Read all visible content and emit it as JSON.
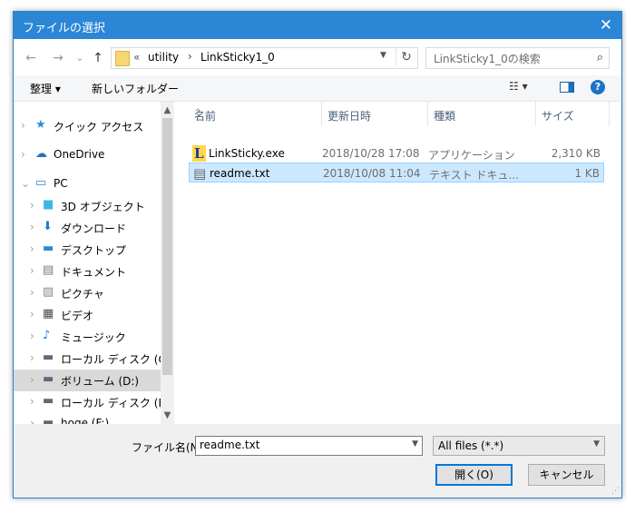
{
  "window": {
    "title": "ファイルの選択",
    "close_glyph": "✕"
  },
  "nav_buttons": {
    "back": "←",
    "forward": "→",
    "history": "⌄",
    "up": "↑"
  },
  "address": {
    "overflow": "«",
    "parts": [
      "utility",
      "LinkSticky1_0"
    ],
    "separator": "›"
  },
  "search": {
    "placeholder": "LinkSticky1_0の検索",
    "icon": "search-icon"
  },
  "toolbar": {
    "organize_label": "整理 ▾",
    "new_folder_label": "新しいフォルダー",
    "view_icon": "☷ ▾",
    "help_label": "?"
  },
  "nav_pane": {
    "items": [
      {
        "label": "クイック アクセス",
        "icon": "star-icon",
        "color": "#2e8dd8"
      },
      {
        "label": "OneDrive",
        "icon": "cloud-icon",
        "color": "#1f73c6"
      },
      {
        "label": "PC",
        "icon": "computer-icon",
        "color": "#2a8bd6"
      },
      {
        "label": "3D オブジェクト",
        "icon": "cube-icon",
        "color": "#3cb7e6"
      },
      {
        "label": "ダウンロード",
        "icon": "download-icon",
        "color": "#1e79d0"
      },
      {
        "label": "デスクトップ",
        "icon": "desktop-icon",
        "color": "#2a8bd6"
      },
      {
        "label": "ドキュメント",
        "icon": "document-icon",
        "color": "#6d7a88"
      },
      {
        "label": "ピクチャ",
        "icon": "picture-icon",
        "color": "#7f8c99"
      },
      {
        "label": "ビデオ",
        "icon": "video-icon",
        "color": "#4a4a4a"
      },
      {
        "label": "ミュージック",
        "icon": "music-icon",
        "color": "#1e79d0"
      },
      {
        "label": "ローカル ディスク (C:)",
        "icon": "drive-c-icon",
        "color": "#5a6b7c"
      },
      {
        "label": "ボリューム (D:)",
        "icon": "drive-icon",
        "color": "#5a6b7c"
      },
      {
        "label": "ローカル ディスク (E:)",
        "icon": "drive-icon",
        "color": "#5a6b7c"
      },
      {
        "label": "hoge (F:)",
        "icon": "drive-icon",
        "color": "#5a6b7c"
      }
    ],
    "selected": "ボリューム (D:)"
  },
  "file_list": {
    "columns": [
      "名前",
      "更新日時",
      "種類",
      "サイズ"
    ],
    "sort_indicator": "^",
    "rows": [
      {
        "name": "LinkSticky.exe",
        "date": "2018/10/28 17:08",
        "type": "アプリケーション",
        "size": "2,310 KB",
        "icon": "app-icon"
      },
      {
        "name": "readme.txt",
        "date": "2018/10/08 11:04",
        "type": "テキスト ドキュ...",
        "size": "1 KB",
        "icon": "text-file-icon"
      }
    ],
    "selected": "readme.txt"
  },
  "footer": {
    "filename_label": "ファイル名(N):",
    "filename_value": "readme.txt",
    "filetype_value": "All files (*.*)",
    "open_label": "開く(O)",
    "cancel_label": "キャンセル"
  },
  "colors": {
    "titlebar": "#2b86d6",
    "selection": "#cce8ff",
    "nav_selection": "#d9d9d9",
    "accent": "#0078d7"
  }
}
